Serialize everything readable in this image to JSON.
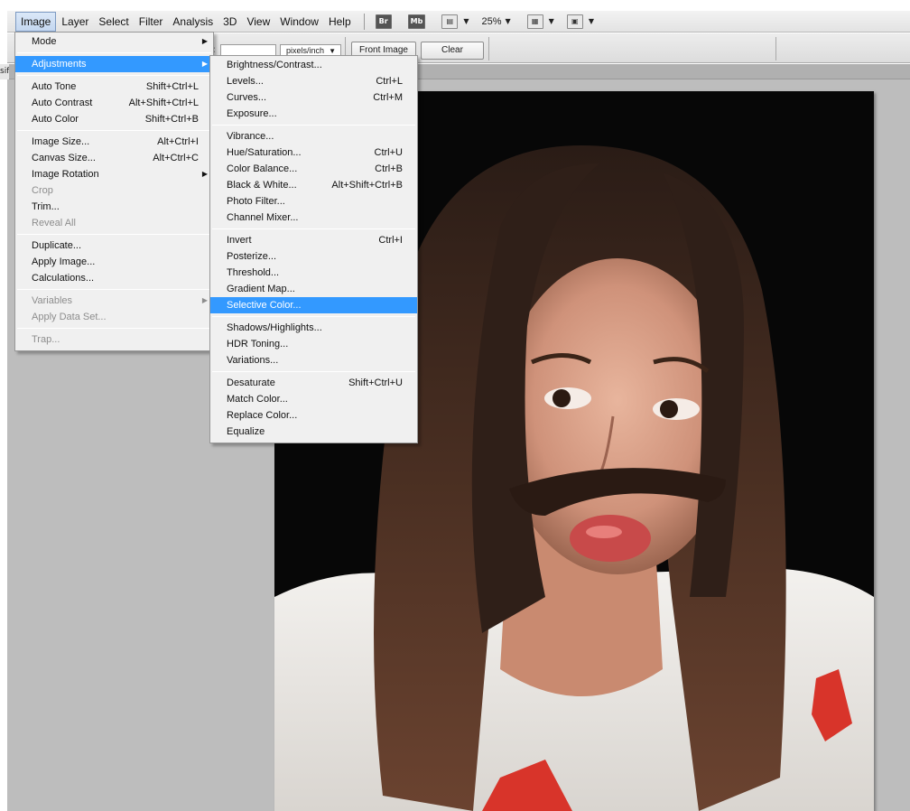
{
  "menubar": {
    "items": [
      "Image",
      "Layer",
      "Select",
      "Filter",
      "Analysis",
      "3D",
      "View",
      "Window",
      "Help"
    ],
    "bridge_label": "Br",
    "minibridge_label": "Mb",
    "zoom": "25%"
  },
  "options": {
    "resolution_unit": "pixels/inch",
    "front_image_label": "Front Image",
    "clear_label": "Clear",
    "colon": ":"
  },
  "doc_tab_label": "sif",
  "image_menu": {
    "items": [
      {
        "label": "Mode",
        "shortcut": "",
        "submenu": true,
        "disabled": false
      },
      {
        "sep": true
      },
      {
        "label": "Adjustments",
        "shortcut": "",
        "submenu": true,
        "disabled": false,
        "highlighted": true
      },
      {
        "sep": true
      },
      {
        "label": "Auto Tone",
        "shortcut": "Shift+Ctrl+L"
      },
      {
        "label": "Auto Contrast",
        "shortcut": "Alt+Shift+Ctrl+L"
      },
      {
        "label": "Auto Color",
        "shortcut": "Shift+Ctrl+B"
      },
      {
        "sep": true
      },
      {
        "label": "Image Size...",
        "shortcut": "Alt+Ctrl+I"
      },
      {
        "label": "Canvas Size...",
        "shortcut": "Alt+Ctrl+C"
      },
      {
        "label": "Image Rotation",
        "shortcut": "",
        "submenu": true
      },
      {
        "label": "Crop",
        "shortcut": "",
        "disabled": true
      },
      {
        "label": "Trim...",
        "shortcut": ""
      },
      {
        "label": "Reveal All",
        "shortcut": "",
        "disabled": true
      },
      {
        "sep": true
      },
      {
        "label": "Duplicate...",
        "shortcut": ""
      },
      {
        "label": "Apply Image...",
        "shortcut": ""
      },
      {
        "label": "Calculations...",
        "shortcut": ""
      },
      {
        "sep": true
      },
      {
        "label": "Variables",
        "shortcut": "",
        "submenu": true,
        "disabled": true
      },
      {
        "label": "Apply Data Set...",
        "shortcut": "",
        "disabled": true
      },
      {
        "sep": true
      },
      {
        "label": "Trap...",
        "shortcut": "",
        "disabled": true
      }
    ]
  },
  "adjustments_menu": {
    "items": [
      {
        "label": "Brightness/Contrast...",
        "shortcut": ""
      },
      {
        "label": "Levels...",
        "shortcut": "Ctrl+L"
      },
      {
        "label": "Curves...",
        "shortcut": "Ctrl+M"
      },
      {
        "label": "Exposure...",
        "shortcut": ""
      },
      {
        "sep": true
      },
      {
        "label": "Vibrance...",
        "shortcut": ""
      },
      {
        "label": "Hue/Saturation...",
        "shortcut": "Ctrl+U"
      },
      {
        "label": "Color Balance...",
        "shortcut": "Ctrl+B"
      },
      {
        "label": "Black & White...",
        "shortcut": "Alt+Shift+Ctrl+B"
      },
      {
        "label": "Photo Filter...",
        "shortcut": ""
      },
      {
        "label": "Channel Mixer...",
        "shortcut": ""
      },
      {
        "sep": true
      },
      {
        "label": "Invert",
        "shortcut": "Ctrl+I"
      },
      {
        "label": "Posterize...",
        "shortcut": ""
      },
      {
        "label": "Threshold...",
        "shortcut": ""
      },
      {
        "label": "Gradient Map...",
        "shortcut": ""
      },
      {
        "label": "Selective Color...",
        "shortcut": "",
        "highlighted": true
      },
      {
        "sep": true
      },
      {
        "label": "Shadows/Highlights...",
        "shortcut": ""
      },
      {
        "label": "HDR Toning...",
        "shortcut": ""
      },
      {
        "label": "Variations...",
        "shortcut": ""
      },
      {
        "sep": true
      },
      {
        "label": "Desaturate",
        "shortcut": "Shift+Ctrl+U"
      },
      {
        "label": "Match Color...",
        "shortcut": ""
      },
      {
        "label": "Replace Color...",
        "shortcut": ""
      },
      {
        "label": "Equalize",
        "shortcut": ""
      }
    ]
  },
  "colors": {
    "highlight": "#3399ff",
    "menu_bg": "#f0f0f0",
    "workspace": "#bdbdbd"
  },
  "icons": {
    "submenu_arrow": "triangle-right-icon",
    "dropdown": "triangle-down-icon"
  }
}
